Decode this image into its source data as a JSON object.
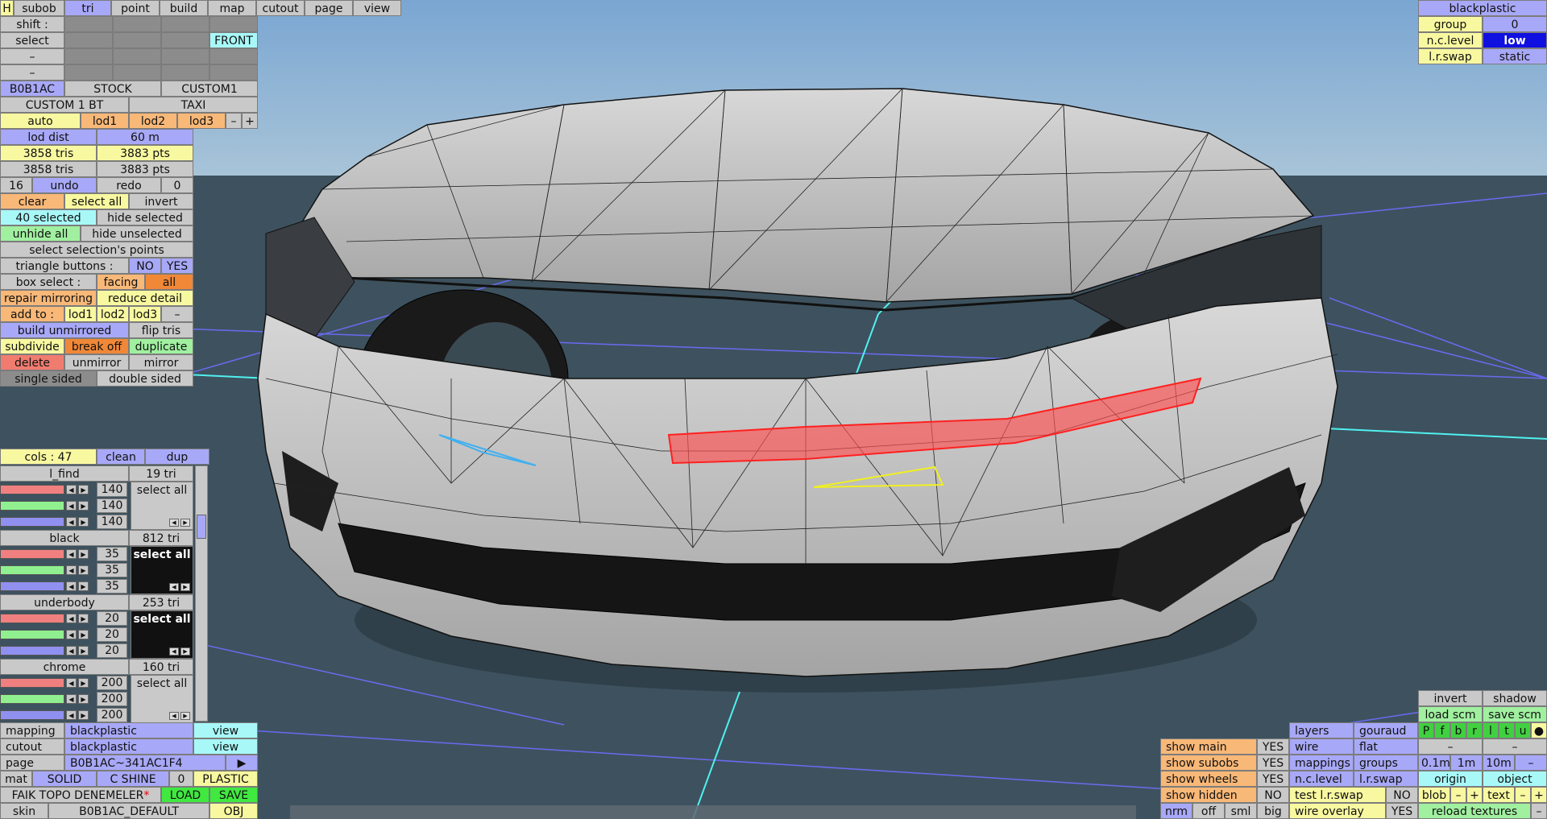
{
  "tabs": {
    "h": "H",
    "subob": "subob",
    "tri": "tri",
    "point": "point",
    "build": "build",
    "map": "map",
    "cutout": "cutout",
    "page": "page",
    "view": "view"
  },
  "sel": {
    "shift": "shift :",
    "select": "select",
    "front": "FRONT",
    "dash1": "–",
    "dash2": "–"
  },
  "variants": {
    "v1": "B0B1AC",
    "v2": "STOCK",
    "v3": "CUSTOM1",
    "v4": "CUSTOM 1 BT",
    "v5": "TAXI"
  },
  "lod": {
    "auto": "auto",
    "lod1": "lod1",
    "lod2": "lod2",
    "lod3": "lod3",
    "minus": "–",
    "plus": "+",
    "dist_label": "lod dist",
    "dist_val": "60 m",
    "tris1": "3858 tris",
    "pts1": "3883 pts",
    "tris2": "3858 tris",
    "pts2": "3883 pts"
  },
  "edit": {
    "undo_count": "16",
    "undo": "undo",
    "redo": "redo",
    "redo_count": "0",
    "clear": "clear",
    "select_all": "select all",
    "invert": "invert",
    "selected": "40 selected",
    "hide_selected": "hide selected",
    "unhide_all": "unhide all",
    "hide_unselected": "hide unselected",
    "select_points": "select selection's points",
    "tri_buttons": "triangle buttons :",
    "no": "NO",
    "yes": "YES",
    "box_select": "box select :",
    "facing": "facing",
    "all": "all",
    "repair": "repair mirroring",
    "reduce": "reduce detail",
    "add_to": "add to :",
    "add_lod1": "lod1",
    "add_lod2": "lod2",
    "add_lod3": "lod3",
    "add_dash": "–",
    "build_unmirrored": "build unmirrored",
    "flip_tris": "flip tris",
    "subdivide": "subdivide",
    "break_off": "break off",
    "duplicate": "duplicate",
    "delete": "delete",
    "unmirror": "unmirror",
    "mirror": "mirror",
    "single": "single sided",
    "double": "double sided"
  },
  "cols": {
    "label": "cols : 47",
    "clean": "clean",
    "dup": "dup"
  },
  "materials": [
    {
      "name": "l_find",
      "tris": "19 tri",
      "v1": "140",
      "v2": "140",
      "v3": "140",
      "sel": "select all",
      "dark": false
    },
    {
      "name": "black",
      "tris": "812 tri",
      "v1": "35",
      "v2": "35",
      "v3": "35",
      "sel": "select all",
      "dark": true
    },
    {
      "name": "underbody",
      "tris": "253 tri",
      "v1": "20",
      "v2": "20",
      "v3": "20",
      "sel": "select all",
      "dark": true
    },
    {
      "name": "chrome",
      "tris": "160 tri",
      "v1": "200",
      "v2": "200",
      "v3": "200",
      "sel": "select all",
      "dark": false
    }
  ],
  "bottom": {
    "mapping": "mapping",
    "mapping_val": "blackplastic",
    "cutout": "cutout",
    "cutout_val": "blackplastic",
    "view": "view",
    "page": "page",
    "page_val": "B0B1AC~341AC1F4",
    "play": "▶",
    "mat": "mat",
    "solid": "SOLID",
    "cshine": "C SHINE",
    "zero": "0",
    "plastic": "PLASTIC",
    "file": "FAIK TOPO DENEMELER",
    "star": "*",
    "load": "LOAD",
    "save": "SAVE",
    "skin": "skin",
    "skin_val": "B0B1AC_DEFAULT",
    "obj": "OBJ"
  },
  "topright": {
    "material": "blackplastic",
    "group": "group",
    "group_val": "0",
    "nclevel": "n.c.level",
    "nclevel_val": "low",
    "lrswap": "l.r.swap",
    "lrswap_val": "static"
  },
  "br": {
    "invert": "invert",
    "shadow": "shadow",
    "load_scm": "load scm",
    "save_scm": "save scm",
    "layers": "layers",
    "gouraud": "gouraud",
    "layer_letters": [
      "P",
      "f",
      "b",
      "r",
      "l",
      "t",
      "u",
      "●"
    ],
    "dash": "–",
    "show_main": "show main",
    "wire": "wire",
    "flat": "flat",
    "show_subobs": "show subobs",
    "mappings": "mappings",
    "groups": "groups",
    "m01": "0.1m",
    "m1": "1m",
    "m10": "10m",
    "show_wheels": "show wheels",
    "nclevel": "n.c.level",
    "lrswap": "l.r.swap",
    "origin": "origin",
    "object": "object",
    "show_hidden": "show hidden",
    "no": "NO",
    "test_lr": "test l.r.swap",
    "blob": "blob",
    "minus": "–",
    "plus": "+",
    "text": "text",
    "nrm": "nrm",
    "off": "off",
    "sml": "sml",
    "big": "big",
    "wire_overlay": "wire overlay",
    "yes": "YES",
    "reload": "reload textures"
  },
  "colors": {
    "sky": "#8fb4d6",
    "ground": "#3a4f5c",
    "selected_red": "#ff5050",
    "grid": "#6a6af0",
    "axis": "#50f0f0"
  }
}
